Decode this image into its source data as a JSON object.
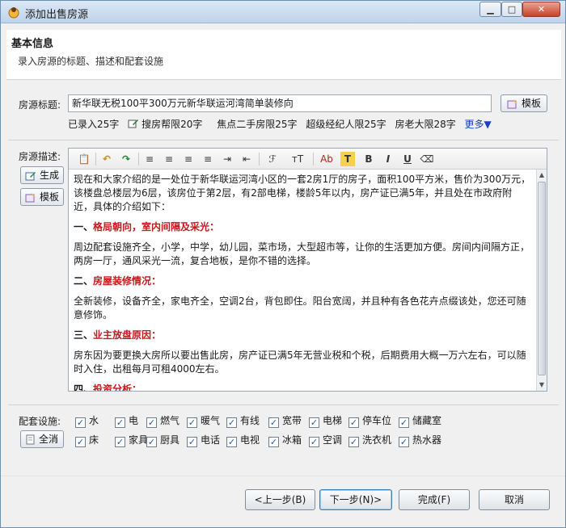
{
  "window": {
    "title": "添加出售房源",
    "min": "0",
    "max": "1",
    "close": "r"
  },
  "header": {
    "title": "基本信息",
    "subtitle": "录入房源的标题、描述和配套设施"
  },
  "title_section": {
    "label": "房源标题:",
    "value": "新华联无税100平300万元新华联运河湾简单装修向",
    "template_button": "模板"
  },
  "limits": [
    {
      "text": "已录入25字"
    },
    {
      "text": "搜房帮限20字",
      "icon": "edit-icon"
    },
    {
      "text": "焦点二手房限25字"
    },
    {
      "text": "超级经纪人限25字"
    },
    {
      "text": "房老大限28字"
    }
  ],
  "more_link": "更多▼",
  "desc_section": {
    "label": "房源描述:",
    "generate_button": "生成",
    "template_button": "模板"
  },
  "toolbar_glyphs": {
    "paste": "📋",
    "undo": "↶",
    "redo": "↷",
    "align_left": "≡",
    "align_center": "≡",
    "align_right": "≡",
    "justify": "≡",
    "indent": "⇥",
    "outdent": "⇤",
    "font": "ℱ",
    "font_size": "ᴛT",
    "font_color": "Ab",
    "highlight": "T",
    "bold": "B",
    "italic": "I",
    "underline": "U",
    "eraser": "⌫"
  },
  "description": {
    "p1": "现在和大家介绍的是一处位于新华联运河湾小区的一套2房1厅的房子，面积100平方米，售价为300万元，该楼盘总楼层为6层，该房位于第2层，有2部电梯，楼龄5年以内，房产证已满5年，并且处在市政府附近，具体的介绍如下：",
    "h1_prefix": "一、",
    "h1": "格局朝向，室内间隔及采光：",
    "p2": "周边配套设施齐全，小学，中学，幼儿园，菜市场，大型超市等，让你的生活更加方便。房间内间隔方正，两房一厅，通风采光一流，复合地板，是你不错的选择。",
    "h2_prefix": "二、",
    "h2": "房屋装修情况：",
    "p3": "全新装修，设备齐全，家电齐全，空调2台，背包即住。阳台宽阔，并且种有各色花卉点缀该处，您还可随意修饰。",
    "h3_prefix": "三、",
    "h3": "业主放盘原因：",
    "p4": "房东因为要更换大房所以要出售此房，房产证已满5年无营业税和个税，后期费用大概一万六左右，可以随时入住，出租每月可租4000左右。",
    "h4_prefix": "四、",
    "h4": "投资分析："
  },
  "facilities": {
    "label": "配套设施:",
    "select_all": "全消",
    "row1": [
      "水",
      "电",
      "燃气",
      "暖气",
      "有线",
      "宽带",
      "电梯",
      "停车位",
      "储藏室"
    ],
    "row2": [
      "床",
      "家具",
      "厨具",
      "电话",
      "电视",
      "冰箱",
      "空调",
      "洗衣机",
      "热水器"
    ],
    "check": "✓"
  },
  "footer": {
    "prev": "<上一步(B)",
    "next": "下一步(N)>",
    "finish": "完成(F)",
    "cancel": "取消"
  },
  "colors": {
    "accent_red": "#c8161d",
    "link_blue": "#1a3fbf"
  }
}
